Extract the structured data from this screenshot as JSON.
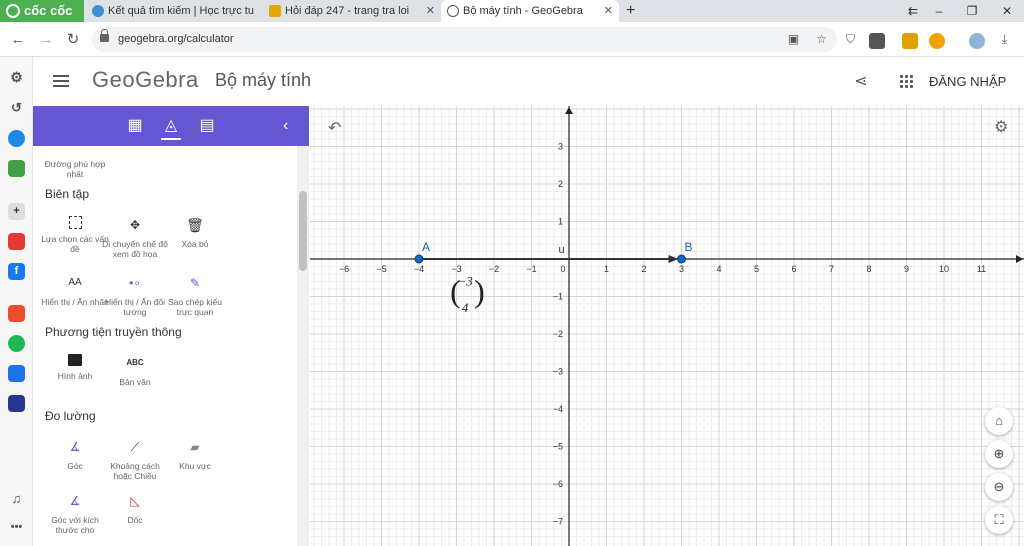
{
  "browser": {
    "brand": "cốc cốc",
    "tabs": [
      {
        "title": "Kết quả tìm kiếm | Học trực tu"
      },
      {
        "title": "Hỏi đáp 247 - trang tra loi"
      },
      {
        "title": "Bộ máy tính - GeoGebra"
      }
    ],
    "url": "geogebra.org/calculator"
  },
  "app": {
    "logo": "GeoGebra",
    "title": "Bộ máy tính",
    "login_label": "ĐĂNG NHẬP"
  },
  "toolbox": {
    "top_tool_label": "Đường phù hợp nhất",
    "sections": [
      {
        "title": "Biên tập",
        "tools": [
          "Lựa chọn các vấn đề",
          "Di chuyển chế độ xem đồ họa",
          "Xóa bỏ",
          "Hiển thị / Ẩn nhãn",
          "Hiển thị / Ẩn đối tượng",
          "Sao chép kiểu trực quan"
        ]
      },
      {
        "title": "Phương tiện truyền thông",
        "tools": [
          "Hình ảnh",
          "Bản văn"
        ]
      },
      {
        "title": "Đo lường",
        "tools": [
          "Góc",
          "Khoảng cách hoặc Chiều",
          "Khu vực",
          "Góc với kích thước cho",
          "Dốc"
        ]
      }
    ],
    "icon_texts": {
      "abc": "ABC",
      "aa": "AA"
    }
  },
  "graphics": {
    "x_ticks": [
      "−6",
      "−5",
      "−4",
      "−3",
      "−2",
      "−1",
      "0",
      "1",
      "2",
      "3",
      "4",
      "5",
      "6",
      "7",
      "8",
      "9",
      "10",
      "11"
    ],
    "y_ticks": [
      "3",
      "2",
      "1",
      "−1",
      "−2",
      "−3",
      "−4",
      "−5",
      "−6",
      "−7"
    ],
    "points": [
      {
        "label": "A",
        "x": -4,
        "y": 0
      },
      {
        "label": "B",
        "x": 3,
        "y": 0
      }
    ],
    "vector": {
      "label": "u",
      "from": "A",
      "to": "B"
    },
    "vector_text": {
      "top": "−3",
      "bottom": "4"
    },
    "colors": {
      "point": "#1565c0",
      "label": "#1565c0",
      "vector": "#333333",
      "grid_minor": "#eeeeee",
      "grid_major": "#d6d6d6"
    }
  }
}
